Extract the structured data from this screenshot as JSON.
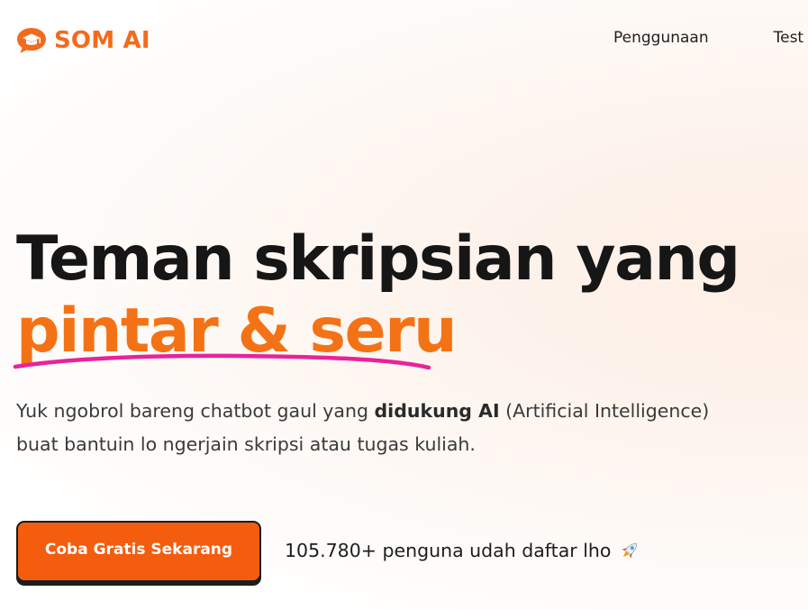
{
  "brand": {
    "name": "SOM AI",
    "color": "#f26b1d",
    "icon": "graduation-cap-chat-bubble-icon"
  },
  "nav": {
    "items": [
      {
        "label": "Penggunaan"
      },
      {
        "label": "Test"
      }
    ]
  },
  "hero": {
    "title_line1": "Teman skripsian yang",
    "title_accent": "pintar & seru",
    "accent_color": "#f47216",
    "underline_color": "#e8239a",
    "subtitle_part1": "Yuk ngobrol bareng chatbot gaul yang ",
    "subtitle_bold": "didukung AI",
    "subtitle_part2": " (Artificial Intelligence) buat bantuin lo ngerjain skripsi atau tugas kuliah."
  },
  "cta": {
    "label": "Coba Gratis Sekarang",
    "color": "#f45c0e"
  },
  "social_proof": {
    "text": "105.780+ penguna udah daftar lho",
    "icon": "rocket-icon"
  }
}
